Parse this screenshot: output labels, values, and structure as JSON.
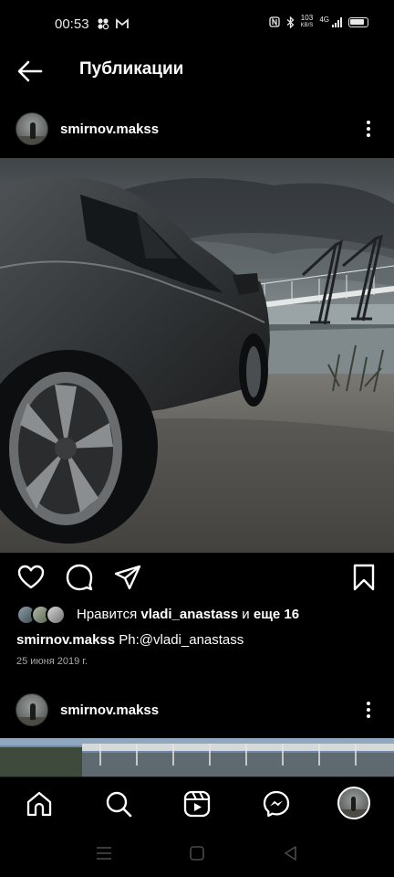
{
  "status_bar": {
    "time": "00:53",
    "left_icons": [
      "app-icon",
      "gmail-icon"
    ],
    "speed_value": "103",
    "speed_unit": "KB/S",
    "network": "4G"
  },
  "app_bar": {
    "title": "Публикации",
    "back_icon": "arrow-left-icon"
  },
  "posts": [
    {
      "username": "smirnov.makss",
      "image": "grey-car-by-river-harbour-cranes-bridge",
      "likes": {
        "prefix": "Нравится",
        "user": "vladi_anastass",
        "middle": "и",
        "suffix": "еще 16"
      },
      "caption": {
        "author": "smirnov.makss",
        "text": "Ph:@vladi_anastass"
      },
      "date": "25 июня 2019 г."
    },
    {
      "username": "smirnov.makss",
      "image": "bridge-under-blue-sky"
    }
  ],
  "actions": [
    "heart-icon",
    "comment-icon",
    "share-icon",
    "bookmark-icon"
  ],
  "bottom_nav": [
    "home-icon",
    "search-icon",
    "reels-icon",
    "messenger-icon",
    "profile-avatar"
  ],
  "system_nav": [
    "menu-icon",
    "home-square-icon",
    "back-triangle-icon"
  ],
  "colors": {
    "background": "#000000",
    "text": "#ffffff",
    "secondary_text": "#a8a8a8"
  }
}
